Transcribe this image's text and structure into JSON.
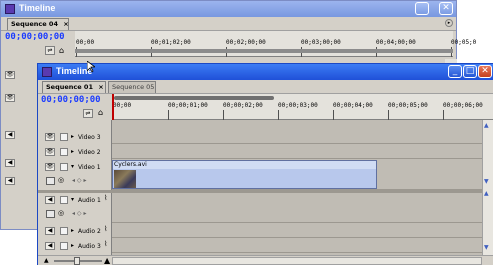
{
  "back_window": {
    "title": "Timeline",
    "tab_label": "Sequence 04",
    "tab_close": "×",
    "timecode": "00;00;00;00",
    "ruler_ticks": [
      "00;00",
      "00;01;02;00",
      "00;02;00;00",
      "00;03;00;00",
      "00;04;00;00",
      "00;05;0"
    ],
    "menu_glyph": "▸"
  },
  "front_window": {
    "title": "Timeline",
    "tabs": [
      {
        "label": "Sequence 01",
        "close": "×",
        "active": true
      },
      {
        "label": "Sequence 05",
        "active": false
      }
    ],
    "timecode": "00;00;00;00",
    "ruler_ticks": [
      "00;00",
      "00;00;01;00",
      "00;00;02;00",
      "00;00;03;00",
      "00;00;04;00",
      "00;00;05;00",
      "00;00;06;00"
    ],
    "video_tracks": [
      {
        "name": "Video 3"
      },
      {
        "name": "Video 2"
      },
      {
        "name": "Video 1"
      }
    ],
    "clip": {
      "name": "Cyclers.avi"
    },
    "audio_tracks": [
      {
        "name": "Audio 1"
      },
      {
        "name": "Audio 2"
      },
      {
        "name": "Audio 3"
      }
    ],
    "title_buttons": {
      "minimize": "_",
      "maximize": "□",
      "close": "✕"
    },
    "scroll_up": "▲",
    "scroll_down": "▼",
    "zoom_minus": "▲",
    "zoom_plus": "▲"
  },
  "colors": {
    "titlebar_blue": "#2860e0",
    "titlebar_inactive": "#7f9fe6",
    "timecode": "#1c3cff",
    "clip_header": "#d0dcf4",
    "clip_body": "#b8c8ec"
  }
}
